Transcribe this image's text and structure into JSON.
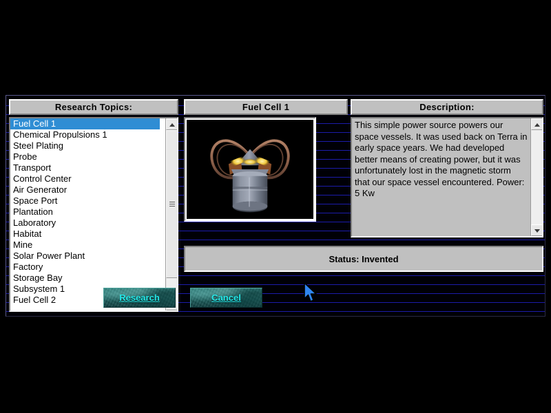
{
  "window": {
    "background_color": "#000000",
    "stripe_color": "#1c1caa"
  },
  "panels": {
    "topics_caption": "Research Topics:",
    "title_caption": "Fuel Cell 1",
    "description_caption": "Description:"
  },
  "topics": {
    "selected_index": 0,
    "items": [
      "Fuel Cell 1",
      "Chemical Propulsions 1",
      "Steel Plating",
      "Probe",
      "Transport",
      "Control Center",
      "Air Generator",
      "Space Port",
      "Plantation",
      "Laboratory",
      "Habitat",
      "Mine",
      "Solar Power Plant",
      "Factory",
      "Storage Bay",
      "Subsystem 1",
      "Fuel Cell 2"
    ]
  },
  "preview": {
    "alt": "fuel-cell-render",
    "body_color": "#8c929e",
    "coil_color": "#9c6a52",
    "glow_color": "#f2d24a"
  },
  "description": {
    "text": "This simple power source powers our space vessels.  It was used back on Terra in early space years. We had developed better means of creating power, but it was unfortunately lost in the magnetic storm that our space vessel encountered.  Power: 5 Kw"
  },
  "status": {
    "text": "Status: Invented"
  },
  "buttons": {
    "research": {
      "accel": "R",
      "rest": "esearch"
    },
    "cancel": {
      "accel": "C",
      "rest": "ancel"
    },
    "text_color": "#25e8e8"
  }
}
